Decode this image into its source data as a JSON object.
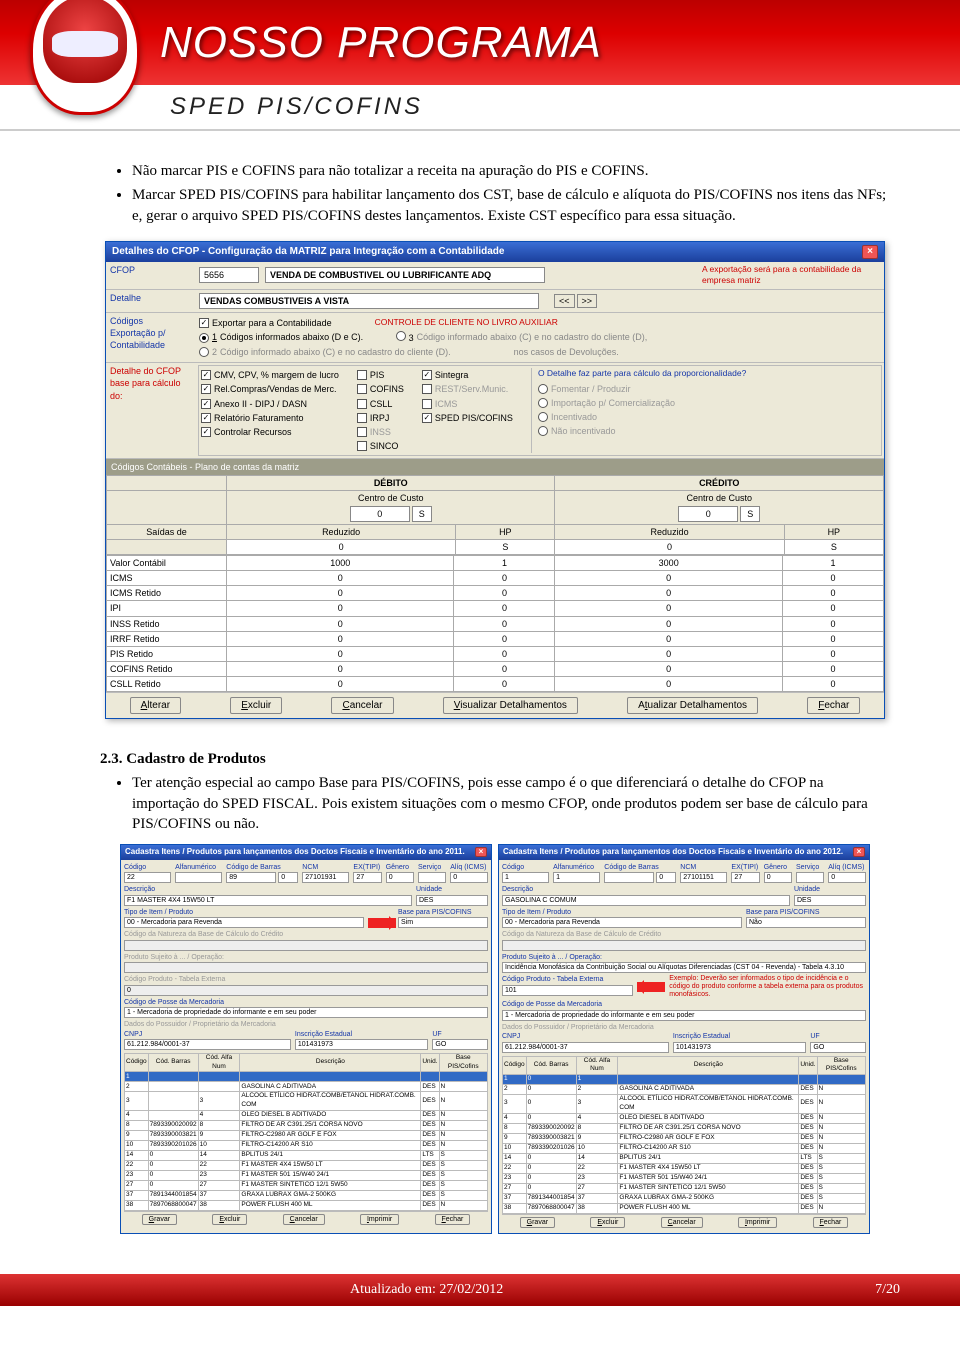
{
  "header": {
    "main": "NOSSO PROGRAMA",
    "sub": "SPED PIS/COFINS"
  },
  "bullets": [
    "Não marcar PIS e COFINS para não totalizar a receita na apuração do PIS e COFINS.",
    "Marcar SPED PIS/COFINS para habilitar lançamento dos CST, base de cálculo e alíquota do PIS/COFINS nos itens das NFs; e, gerar o arquivo SPED PIS/COFINS destes lançamentos. Existe CST específico para essa situação."
  ],
  "cfop_window": {
    "title": "Detalhes do CFOP - Configuração da MATRIZ para Integração com a Contabilidade",
    "cfop_label": "CFOP",
    "cfop_value": "5656",
    "cfop_desc": "VENDA DE COMBUSTIVEL OU LUBRIFICANTE ADQ",
    "detalhe_label": "Detalhe",
    "detalhe_value": "VENDAS COMBUSTIVEIS A VISTA",
    "red_note_top": "A exportação será para a contabilidade da empresa matriz",
    "codigos_label1": "Códigos",
    "codigos_label2": "Exportação p/",
    "codigos_label3": "Contabilidade",
    "exportar_cb": "Exportar para a Contabilidade",
    "controle_cliente": "CONTROLE DE CLIENTE NO LIVRO AUXILIAR",
    "opt1": "Códigos informados abaixo (D e C).",
    "opt2": "Código informado abaixo (C) e no cadastro do cliente (D).",
    "gray_note": "nos casos de Devoluções.",
    "detalhe_cfop_label": "Detalhe do CFOP base para cálculo do:",
    "calc_col1": [
      "CMV, CPV, % margem de lucro",
      "Rel.Compras/Vendas de Merc.",
      "Anexo II - DIPJ / DASN",
      "Relatório Faturamento",
      "Controlar Recursos"
    ],
    "calc_col2": [
      "PIS",
      "COFINS",
      "CSLL",
      "IRPJ",
      "INSS",
      "SINCO"
    ],
    "calc_col3": [
      "Sintegra",
      "REST/Serv.Munic.",
      "ICMS",
      "SPED PIS/COFINS"
    ],
    "prop_q": "O Detalhe faz parte para cálculo da proporcionalidade?",
    "prop_opts": [
      "Fomentar / Produzir",
      "Importação p/ Comercialização",
      "Incentivado",
      "Não incentivado"
    ],
    "plano_header": "Códigos Contábeis - Plano de contas da matriz",
    "debito": "DÉBITO",
    "credito": "CRÉDITO",
    "centro_custo": "Centro de Custo",
    "cols": [
      "Saídas de",
      "Reduzido",
      "HP",
      "Reduzido",
      "HP"
    ],
    "rows": [
      [
        "Valor Contábil",
        "1000",
        "1",
        "3000",
        "1"
      ],
      [
        "ICMS",
        "0",
        "0",
        "0",
        "0"
      ],
      [
        "ICMS Retido",
        "0",
        "0",
        "0",
        "0"
      ],
      [
        "IPI",
        "0",
        "0",
        "0",
        "0"
      ],
      [
        "INSS Retido",
        "0",
        "0",
        "0",
        "0"
      ],
      [
        "IRRF Retido",
        "0",
        "0",
        "0",
        "0"
      ],
      [
        "PIS Retido",
        "0",
        "0",
        "0",
        "0"
      ],
      [
        "COFINS Retido",
        "0",
        "0",
        "0",
        "0"
      ],
      [
        "CSLL Retido",
        "0",
        "0",
        "0",
        "0"
      ]
    ],
    "buttons": [
      "Alterar",
      "Excluir",
      "Cancelar",
      "Visualizar Detalhamentos",
      "Atualizar Detalhamentos",
      "Fechar"
    ]
  },
  "section23": {
    "heading": "2.3. Cadastro de Produtos",
    "b1": "Ter atenção especial ao campo Base para PIS/COFINS, pois esse campo é o que diferenciará o detalhe do CFOP na importação do SPED FISCAL. Pois existem situações com o mesmo CFOP, onde produtos podem ser base de cálculo para PIS/COFINS ou não."
  },
  "prod_left": {
    "title": "Cadastra Itens / Produtos para lançamentos dos Doctos Fiscais e Inventário do ano 2011.",
    "codigo": "22",
    "alfa": "",
    "barras": "89",
    "barras_sub": "0",
    "ncm": "27101931",
    "extipi": "27",
    "genero": "0",
    "servico": "",
    "aliq": "0",
    "descricao": "F1 MASTER 4X4 15W50 LT",
    "unidade": "DES",
    "tipo_lbl": "Tipo de Item / Produto",
    "tipo_val": "00 - Mercadoria para Revenda",
    "base_lbl": "Base para PIS/COFINS",
    "base_val": "Sim",
    "natureza_lbl": "Código da Natureza da Base de Cálculo do Crédito",
    "sujeito_lbl": "Produto Sujeito à ... / Operação:",
    "cod_tabela_lbl": "Código Produto - Tabela Externa",
    "cod_tabela_val": "0",
    "posse_lbl": "Código de Posse da Mercadoria",
    "posse_val": "1 - Mercadoria de propriedade do informante e em seu poder",
    "dados_lbl": "Dados do Possuidor / Proprietário da Mercadoria",
    "cnpj_lbl": "CNPJ",
    "cnpj": "61.212.984/0001-37",
    "ie_lbl": "Inscrição Estadual",
    "ie": "101431973",
    "uf_lbl": "UF",
    "uf": "GO",
    "table_cols": [
      "Código",
      "Cód. Barras",
      "Cód. Alfa Num",
      "Descrição",
      "Unid.",
      "Base PIS/Cofins"
    ],
    "rows": [
      [
        "1",
        "",
        "",
        "",
        "",
        ""
      ],
      [
        "2",
        "",
        "",
        "GASOLINA C ADITIVADA",
        "DES",
        "N"
      ],
      [
        "3",
        "",
        "3",
        "ALCOOL ETÍLICO HIDRAT.COMB/ETANOL HIDRAT.COMB. COM",
        "DES",
        "N"
      ],
      [
        "4",
        "",
        "4",
        "OLEO DIESEL B ADITIVADO",
        "DES",
        "N"
      ],
      [
        "8",
        "7893390020092",
        "8",
        "FILTRO DE AR C391.25/1 CORSA NOVO",
        "DES",
        "N"
      ],
      [
        "9",
        "7893390003821",
        "9",
        "FILTRO-C2980  AR GOLF E FOX",
        "DES",
        "N"
      ],
      [
        "10",
        "7893390201026",
        "10",
        "FILTRO-C14200 AR S10",
        "DES",
        "N"
      ],
      [
        "14",
        "0",
        "14",
        "BPLITUS 24/1",
        "LTS",
        "S"
      ],
      [
        "22",
        "0",
        "22",
        "F1 MASTER 4X4 15W50 LT",
        "DES",
        "S"
      ],
      [
        "23",
        "0",
        "23",
        "F1 MASTER 501 15/W40 24/1",
        "DES",
        "S"
      ],
      [
        "27",
        "0",
        "27",
        "F1 MASTER SINTETICO 12/1 5W50",
        "DES",
        "S"
      ],
      [
        "37",
        "7891344001854",
        "37",
        "GRAXA LUBRAX GMA-2  500KG",
        "DES",
        "S"
      ],
      [
        "38",
        "7897068800047",
        "38",
        "POWER FLUSH 400 ML",
        "DES",
        "N"
      ]
    ],
    "buttons": [
      "Gravar",
      "Excluir",
      "Cancelar",
      "Imprimir",
      "Fechar"
    ]
  },
  "prod_right": {
    "title": "Cadastra Itens / Produtos para lançamentos dos Doctos Fiscais e Inventário do ano 2012.",
    "codigo": "1",
    "alfa": "",
    "barras": "1",
    "barras_sub": "0",
    "ncm": "27101151",
    "extipi": "27",
    "genero": "0",
    "servico": "",
    "aliq": "0",
    "descricao": "GASOLINA C COMUM",
    "unidade": "DES",
    "tipo_val": "00 - Mercadoria para Revenda",
    "base_val": "Não",
    "sujeito_val": "Incidência Monofásica da Contribuição Social ou Alíquotas Diferenciadas (CST 04 - Revenda) - Tabela 4.3.10",
    "cod_tabela_val": "101",
    "posse_val": "1 - Mercadoria de propriedade do informante e em seu poder",
    "exemplo": "Exemplo: Deverão ser informados o tipo de incidência e o código do produto conforme a tabela externa para os produtos monofásicos.",
    "cnpj": "61.212.984/0001-37",
    "ie": "101431973",
    "uf": "GO",
    "rows": [
      [
        "1",
        "0",
        "1",
        "",
        "",
        ""
      ],
      [
        "2",
        "0",
        "2",
        "GASOLINA C ADITIVADA",
        "DES",
        "N"
      ],
      [
        "3",
        "0",
        "3",
        "ALCOOL ETÍLICO HIDRAT.COMB/ETANOL HIDRAT.COMB. COM",
        "DES",
        "N"
      ],
      [
        "4",
        "0",
        "4",
        "OLEO DIESEL B ADITIVADO",
        "DES",
        "N"
      ],
      [
        "8",
        "7893390020092",
        "8",
        "FILTRO DE AR C391.25/1 CORSA NOVO",
        "DES",
        "N"
      ],
      [
        "9",
        "7893390003821",
        "9",
        "FILTRO-C2980  AR GOLF E FOX",
        "DES",
        "N"
      ],
      [
        "10",
        "7893390201026",
        "10",
        "FILTRO-C14200 AR S10",
        "DES",
        "N"
      ],
      [
        "14",
        "0",
        "14",
        "BPLITUS 24/1",
        "LTS",
        "S"
      ],
      [
        "22",
        "0",
        "22",
        "F1 MASTER 4X4 15W50 LT",
        "DES",
        "S"
      ],
      [
        "23",
        "0",
        "23",
        "F1 MASTER 501 15/W40 24/1",
        "DES",
        "S"
      ],
      [
        "27",
        "0",
        "27",
        "F1 MASTER SINTETICO 12/1 5W50",
        "DES",
        "S"
      ],
      [
        "37",
        "7891344001854",
        "37",
        "GRAXA LUBRAX GMA-2  500KG",
        "DES",
        "S"
      ],
      [
        "38",
        "7897068800047",
        "38",
        "POWER FLUSH 400 ML",
        "DES",
        "N"
      ]
    ]
  },
  "footer": {
    "updated": "Atualizado em: 27/02/2012",
    "page": "7/20"
  }
}
